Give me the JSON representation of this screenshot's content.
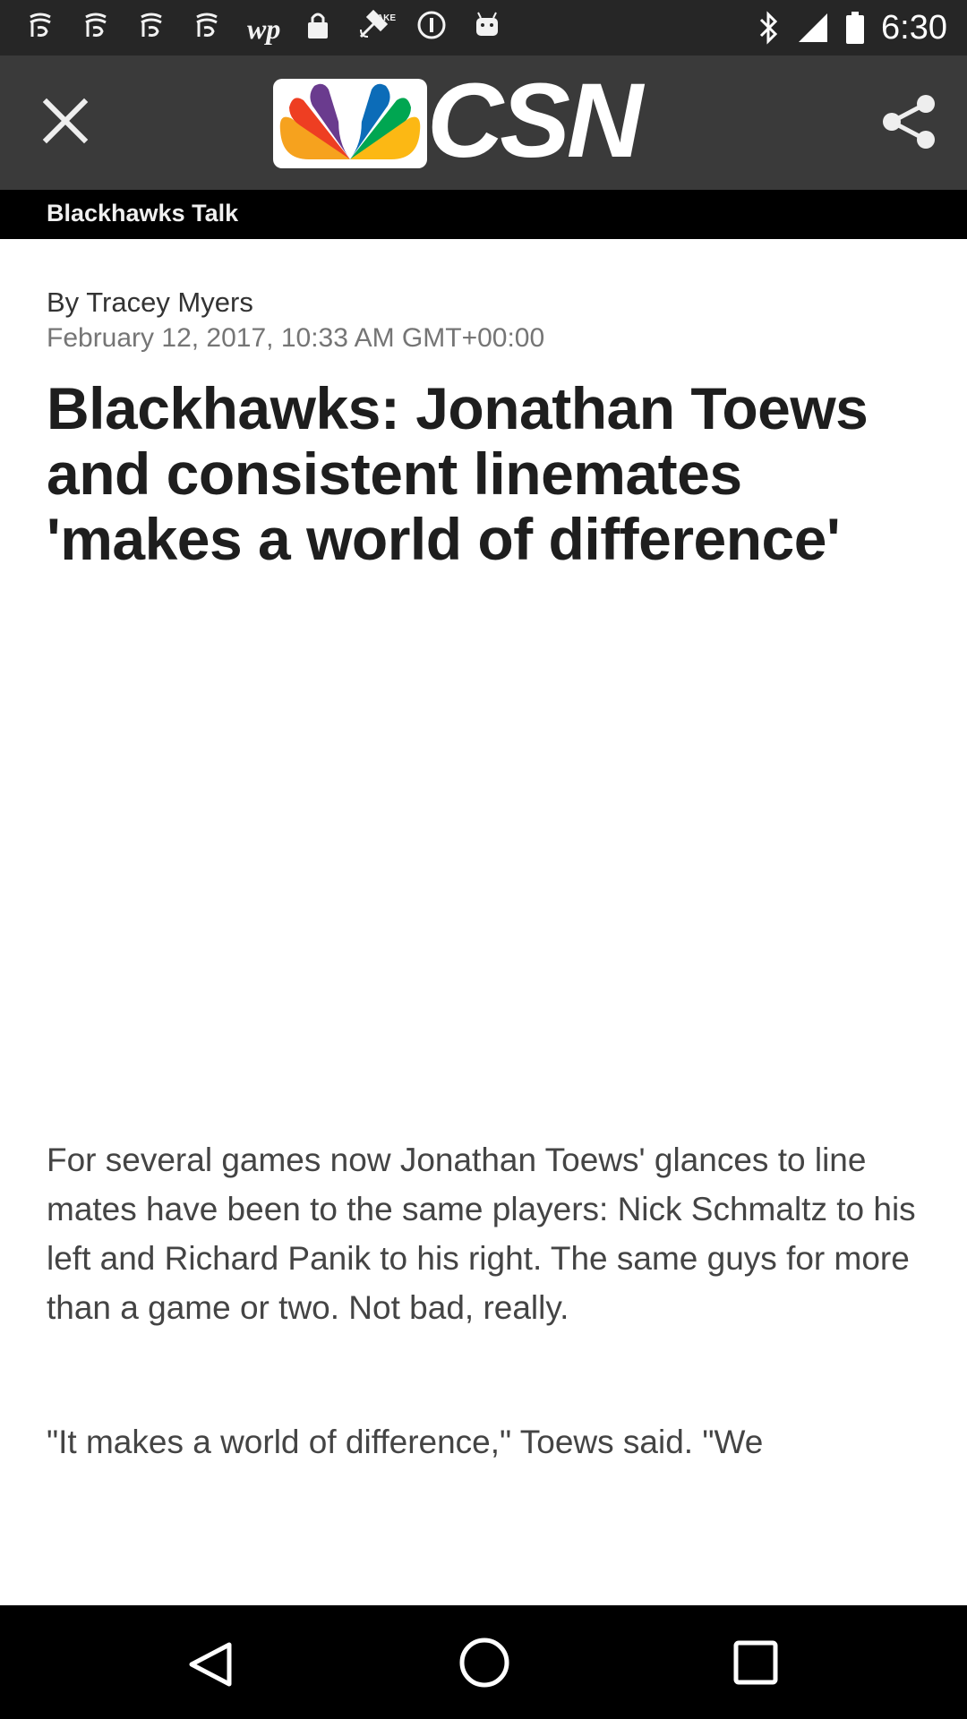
{
  "status_bar": {
    "time": "6:30",
    "left_icons": [
      "notification-icon",
      "notification-icon",
      "notification-icon",
      "notification-icon",
      "washington-post-icon",
      "lock-icon",
      "fake-gps-icon",
      "info-icon",
      "android-icon"
    ],
    "wp_label": "wp",
    "fake_label": "FAKE",
    "right_icons": [
      "bluetooth-icon",
      "signal-icon",
      "battery-icon"
    ]
  },
  "app_bar": {
    "background": "#3a3a3a",
    "logo_text": "CSN",
    "logo_colors": [
      "#f6a21e",
      "#ee3e22",
      "#6a3b8e",
      "#0c6cb8",
      "#00a651",
      "#fcb814"
    ]
  },
  "section": {
    "title": "Blackhawks Talk"
  },
  "article": {
    "byline": "By Tracey Myers",
    "date": "February 12, 2017, 10:33 AM GMT+00:00",
    "headline": "Blackhawks: Jonathan Toews and consistent linemates 'makes a world of difference'",
    "paragraphs": [
      "For several games now Jonathan Toews' glances to line mates have been to the same players: Nick Schmaltz to his left and Richard Panik to his right. The same guys for more than a game or two. Not bad, really.",
      "\"It makes a world of difference,\" Toews said. \"We"
    ]
  },
  "nav_bar": {
    "icons": [
      "back-icon",
      "home-icon",
      "recent-apps-icon"
    ]
  }
}
